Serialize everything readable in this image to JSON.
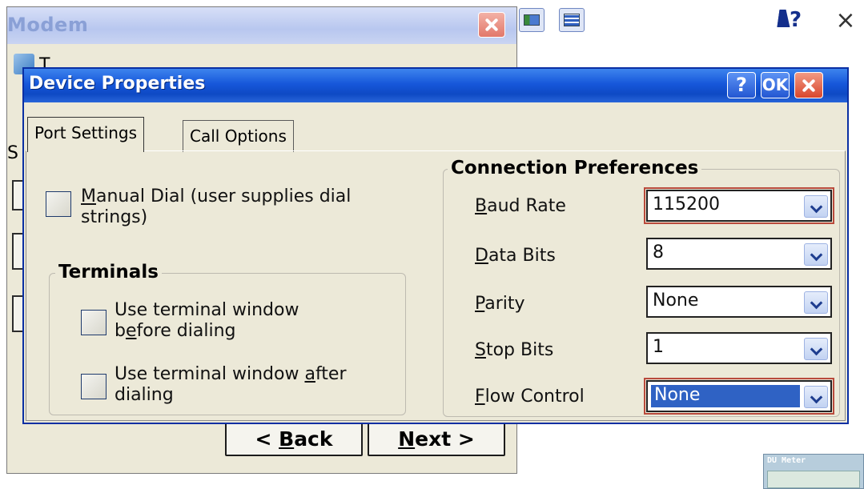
{
  "background_window": {
    "title": "Modem",
    "fragment_1": "T",
    "fragment_2": "S"
  },
  "taskbar": {
    "help_glyph": "?",
    "close_glyph": "×"
  },
  "wizard": {
    "back_prefix": "< ",
    "back_key": "B",
    "back_rest": "ack",
    "next_key": "N",
    "next_rest": "ext >"
  },
  "du_meter": {
    "title": "DU Meter"
  },
  "dialog": {
    "title": "Device Properties",
    "help_label": "?",
    "ok_label": "OK",
    "tabs": [
      "Port Settings",
      "Call Options"
    ],
    "manual_dial": {
      "key": "M",
      "line1_rest": "anual Dial (user supplies dial",
      "line2": "strings)",
      "checked": false
    },
    "terminals": {
      "title": "Terminals",
      "before": {
        "line1": "Use terminal window",
        "line2_pre": "b",
        "line2_key": "e",
        "line2_rest": "fore dialing",
        "checked": false
      },
      "after": {
        "line1_pre": "Use terminal window ",
        "line1_key": "a",
        "line1_rest": "fter",
        "line2": "dialing",
        "checked": false
      }
    },
    "connection": {
      "title": "Connection Preferences",
      "fields": [
        {
          "key": "B",
          "rest": "aud Rate",
          "value": "115200"
        },
        {
          "key": "D",
          "rest": "ata Bits",
          "value": "8"
        },
        {
          "key": "P",
          "rest": "arity",
          "value": "None"
        },
        {
          "key": "S",
          "rest": "top Bits",
          "value": "1"
        },
        {
          "key": "F",
          "rest": "low Control",
          "value": "None"
        }
      ]
    }
  },
  "colors": {
    "titlebar_blue": "#1657da",
    "selection_blue": "#2f62c4",
    "close_red": "#d8462c",
    "highlight_outline": "#b94a3c"
  },
  "icons": [
    "close-icon",
    "help-cursor-icon",
    "chevron-down-icon",
    "app-icon"
  ]
}
